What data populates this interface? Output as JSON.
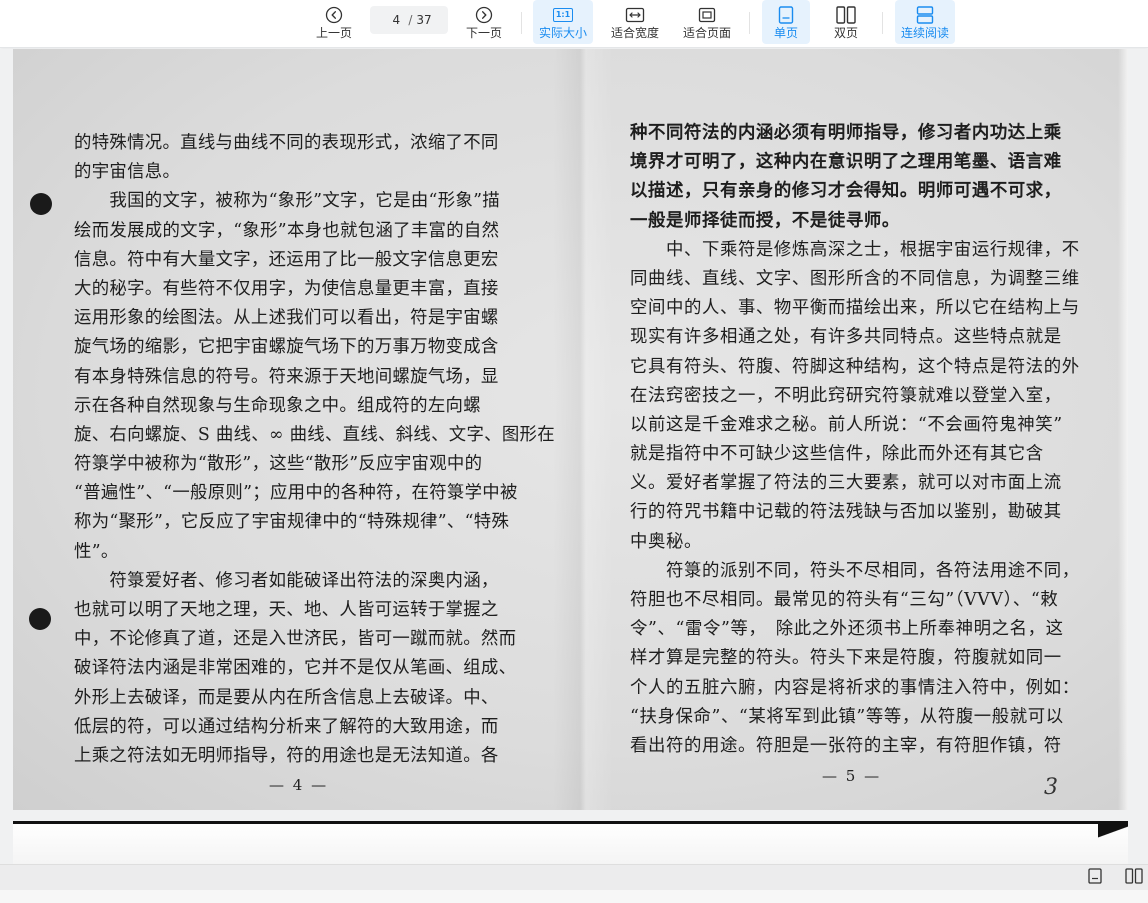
{
  "toolbar": {
    "prev_label": "上一页",
    "next_label": "下一页",
    "current_page": "4",
    "total_pages": "37",
    "actual_size_label": "实际大小",
    "actual_size_icon_text": "1:1",
    "fit_width_label": "适合宽度",
    "fit_page_label": "适合页面",
    "single_page_label": "单页",
    "double_page_label": "双页",
    "continuous_label": "连续阅读",
    "accent_color": "#1a8cf0",
    "active_bg": "#e6f2fd"
  },
  "document": {
    "left_page": {
      "lines": [
        "的特殊情况。直线与曲线不同的表现形式，浓缩了不同",
        "的宇宙信息。",
        "　　我国的文字，被称为“象形”文字，它是由“形象”描",
        "绘而发展成的文字，“象形”本身也就包涵了丰富的自然",
        "信息。符中有大量文字，还运用了比一般文字信息更宏",
        "大的秘字。有些符不仅用字，为使信息量更丰富，直接",
        "运用形象的绘图法。从上述我们可以看出，符是宇宙螺",
        "旋气场的缩影，它把宇宙螺旋气场下的万事万物变成含",
        "有本身特殊信息的符号。符来源于天地间螺旋气场，显",
        "示在各种自然现象与生命现象之中。组成符的左向螺",
        "旋、右向螺旋、S 曲线、∞ 曲线、直线、斜线、文字、图形在",
        "符箓学中被称为“散形”，这些“散形”反应宇宙观中的",
        "“普遍性”、“一般原则”；应用中的各种符，在符箓学中被",
        "称为“聚形”，它反应了宇宙规律中的“特殊规律”、“特殊",
        "性”。",
        "　　符箓爱好者、修习者如能破译出符法的深奥内涵，",
        "也就可以明了天地之理，天、地、人皆可运转于掌握之",
        "中，不论修真了道，还是入世济民，皆可一蹴而就。然而",
        "破译符法内涵是非常困难的，它并不是仅从笔画、组成、",
        "外形上去破译，而是要从内在所含信息上去破译。中、",
        "低层的符，可以通过结构分析来了解符的大致用途，而",
        "上乘之符法如无明师指导，符的用途也是无法知道。各"
      ],
      "page_number": "— 4 —"
    },
    "right_page": {
      "lines": [
        "种不同符法的内涵必须有明师指导，修习者内功达上乘",
        "境界才可明了，这种内在意识明了之理用笔墨、语言难",
        "以描述，只有亲身的修习才会得知。明师可遇不可求，",
        "一般是师择徒而授，不是徒寻师。",
        "　　中、下乘符是修炼高深之士，根据宇宙运行规律，不",
        "同曲线、直线、文字、图形所含的不同信息，为调整三维",
        "空间中的人、事、物平衡而描绘出来，所以它在结构上与",
        "现实有许多相通之处，有许多共同特点。这些特点就是",
        "它具有符头、符腹、符脚这种结构，这个特点是符法的外",
        "在法窍密技之一，不明此窍研究符箓就难以登堂入室，",
        "以前这是千金难求之秘。前人所说：“不会画符鬼神笑”",
        "就是指符中不可缺少这些信件，除此而外还有其它含",
        "义。爱好者掌握了符法的三大要素，就可以对市面上流",
        "行的符咒书籍中记载的符法残缺与否加以鉴别，勘破其",
        "中奥秘。",
        "　　符箓的派别不同，符头不尽相同，各符法用途不同，",
        "符胆也不尽相同。最常见的符头有“三勾”（VVV）、“敕",
        "令”、“雷令”等，　除此之外还须书上所奉神明之名，这",
        "样才算是完整的符头。符头下来是符腹，符腹就如同一",
        "个人的五脏六腑，内容是将祈求的事情注入符中，例如：",
        "“扶身保命”、“某将军到此镇”等等，从符腹一般就可以",
        "看出符的用途。符胆是一张符的主宰，有符胆作镇，符"
      ],
      "page_number": "— 5 —",
      "handwritten_mark": "3"
    }
  },
  "bottombar": {
    "single_icon": "single-page-icon",
    "double_icon": "double-page-icon"
  }
}
